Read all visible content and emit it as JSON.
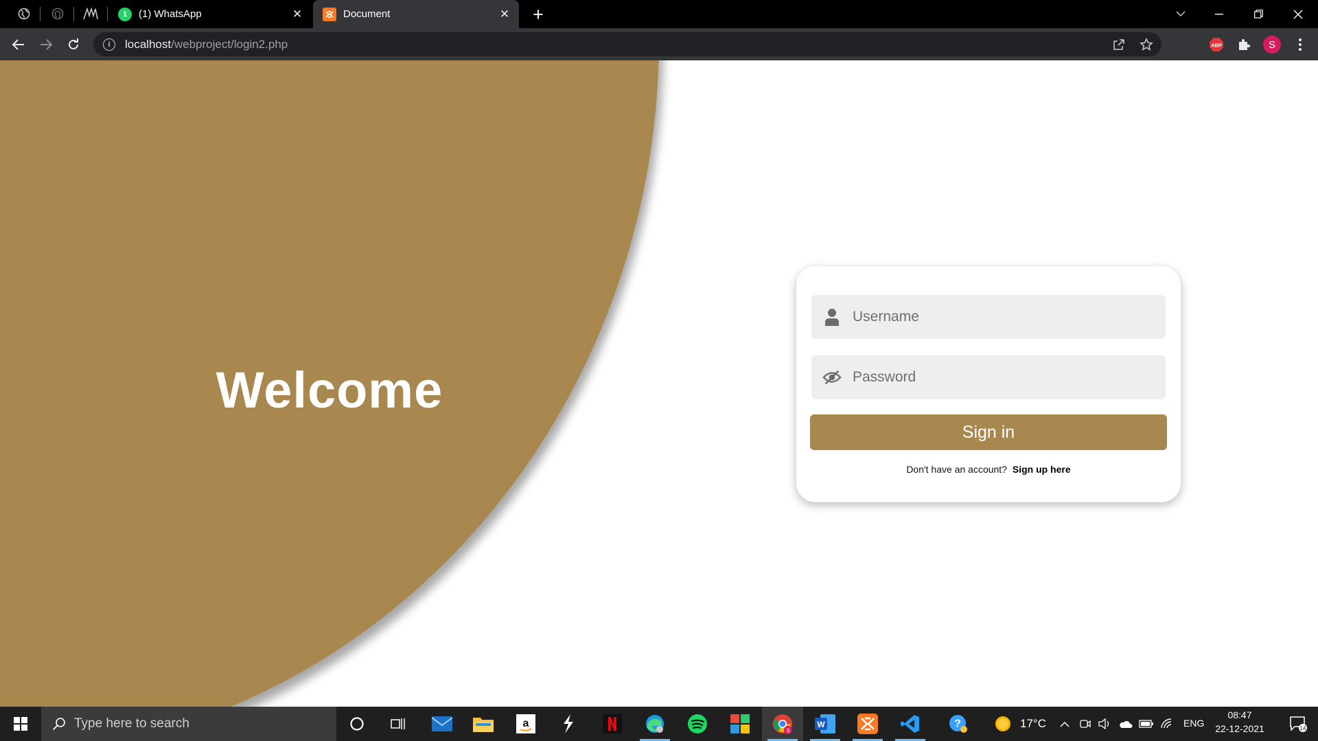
{
  "browser": {
    "tabs": [
      {
        "title": "(1) WhatsApp",
        "close": "✕"
      },
      {
        "title": "Document",
        "close": "✕"
      }
    ],
    "new_tab": "+",
    "tab_search": "⌄",
    "window_controls": {
      "minimize": "—",
      "restore": "❐",
      "close": "✕"
    },
    "url_host": "localhost",
    "url_path": "/webproject/login2.php",
    "profile_initial": "S",
    "abp_label": "ABP"
  },
  "page": {
    "welcome": "Welcome",
    "username_placeholder": "Username",
    "password_placeholder": "Password",
    "signin_label": "Sign in",
    "signup_text": "Don't have an account?",
    "signup_link": "Sign up here",
    "accent_color": "#a8884f"
  },
  "taskbar": {
    "search_placeholder": "Type here to search",
    "weather": "17°C",
    "language": "ENG",
    "time": "08:47",
    "date": "22-12-2021",
    "notifications": "14"
  }
}
